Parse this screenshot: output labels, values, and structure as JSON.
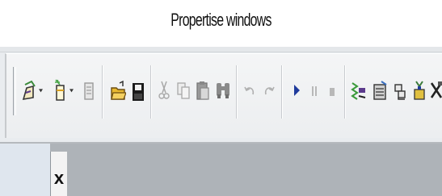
{
  "caption": "Propertise windows",
  "toolbar": {
    "buttons": [
      {
        "name": "new-project-icon",
        "has_dropdown": true
      },
      {
        "name": "add-item-icon",
        "has_dropdown": true
      },
      {
        "name": "add-document-icon",
        "has_dropdown": false
      },
      {
        "name": "open-folder-icon",
        "has_dropdown": false
      },
      {
        "name": "save-icon",
        "has_dropdown": false
      },
      {
        "name": "cut-icon",
        "disabled": true
      },
      {
        "name": "copy-icon",
        "disabled": true
      },
      {
        "name": "paste-icon",
        "disabled": true
      },
      {
        "name": "find-icon",
        "disabled": true
      },
      {
        "name": "undo-icon",
        "disabled": true
      },
      {
        "name": "redo-icon",
        "disabled": true
      },
      {
        "name": "start-icon",
        "disabled": false
      },
      {
        "name": "pause-icon",
        "disabled": true
      },
      {
        "name": "stop-icon",
        "disabled": true
      },
      {
        "name": "solution-explorer-icon",
        "disabled": false
      },
      {
        "name": "properties-icon",
        "disabled": false
      },
      {
        "name": "object-browser-icon",
        "disabled": false
      },
      {
        "name": "toolbox-icon",
        "disabled": false
      },
      {
        "name": "tools-icon",
        "disabled": false
      }
    ],
    "dropdown_glyph": "▾"
  },
  "panel": {
    "close_label": "x"
  }
}
